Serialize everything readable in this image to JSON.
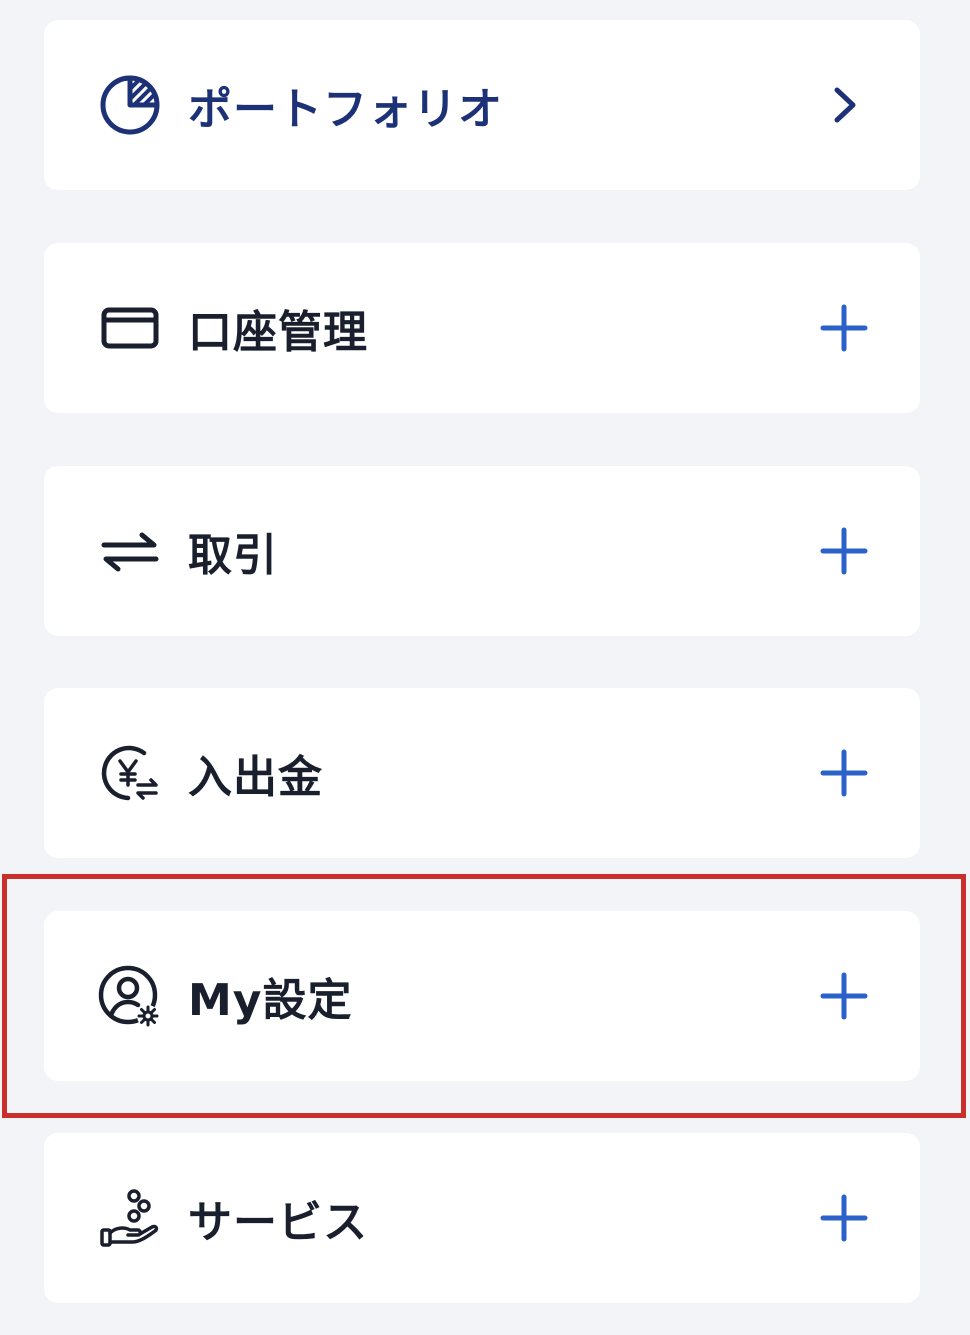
{
  "menu": {
    "items": [
      {
        "label": "ポートフォリオ",
        "icon": "pie-chart-icon",
        "trailing": "chevron-right-icon"
      },
      {
        "label": "口座管理",
        "icon": "card-icon",
        "trailing": "plus-icon"
      },
      {
        "label": "取引",
        "icon": "swap-arrows-icon",
        "trailing": "plus-icon"
      },
      {
        "label": "入出金",
        "icon": "yen-exchange-icon",
        "trailing": "plus-icon"
      },
      {
        "label": "My設定",
        "icon": "user-settings-icon",
        "trailing": "plus-icon"
      },
      {
        "label": "サービス",
        "icon": "hand-coins-icon",
        "trailing": "plus-icon"
      }
    ]
  },
  "colors": {
    "background": "#f3f4f8",
    "card": "#ffffff",
    "accent_navy": "#1d3177",
    "plus_blue": "#2a62c9",
    "text": "#1a1f2e",
    "highlight": "#c9302c"
  }
}
